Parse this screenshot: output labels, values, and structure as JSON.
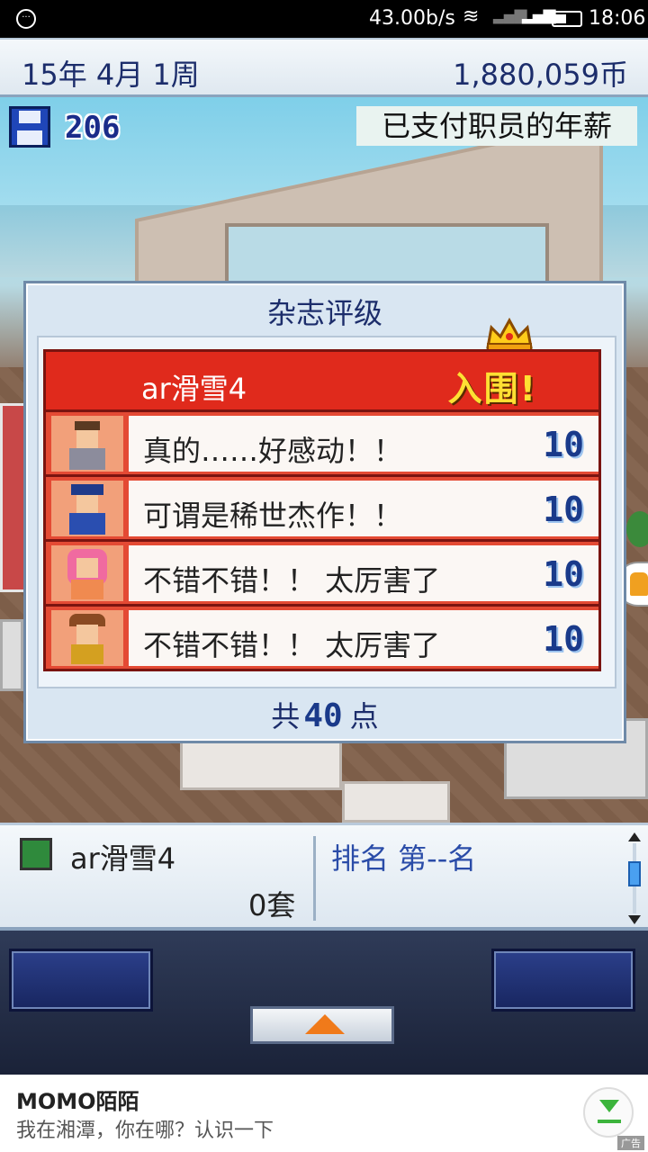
{
  "status_bar": {
    "speed": "43.00b/s",
    "time": "18:06"
  },
  "info_bar": {
    "date": "15年 4月 1周",
    "money": "1,880,059币"
  },
  "scene": {
    "save_count": "206",
    "notice": "已支付职员的年薪"
  },
  "dialog": {
    "title": "杂志评级",
    "game_title": "ar滑雪4",
    "badge": "入围!",
    "reviews": [
      {
        "text": "真的……好感动！！",
        "score": "10"
      },
      {
        "text": "可谓是稀世杰作！！",
        "score": "10"
      },
      {
        "text": "不错不错！！ 太厉害了",
        "score": "10"
      },
      {
        "text": "不错不错！！ 太厉害了",
        "score": "10"
      }
    ],
    "total_prefix": "共",
    "total": "40",
    "total_suffix": "点"
  },
  "panel": {
    "game_name": "ar滑雪4",
    "sets": "0套",
    "rank": "排名 第--名"
  },
  "ad": {
    "title": "MOMO陌陌",
    "text": "我在湘潭，你在哪？认识一下",
    "tag": "广告"
  }
}
